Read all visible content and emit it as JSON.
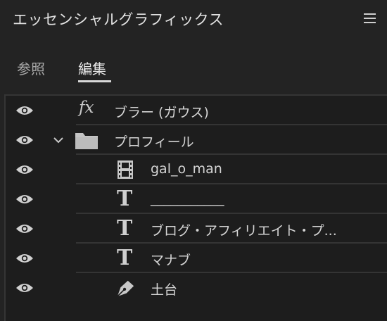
{
  "panel": {
    "title": "エッセンシャルグラフィックス",
    "menu_icon": "hamburger-menu-icon"
  },
  "tabs": [
    {
      "label": "参照",
      "active": false
    },
    {
      "label": "編集",
      "active": true
    }
  ],
  "layers": [
    {
      "label": "ブラー (ガウス)",
      "icon": "fx-effect-icon",
      "visible": true
    },
    {
      "label": "プロフィール",
      "icon": "folder-icon",
      "visible": true,
      "expanded": true
    },
    {
      "label": "gal_o_man",
      "icon": "film-clip-icon",
      "visible": true
    },
    {
      "label": "___________",
      "icon": "text-layer-icon",
      "visible": true
    },
    {
      "label": "ブログ・アフィリエイト・プ...",
      "icon": "text-layer-icon",
      "visible": true
    },
    {
      "label": "マナブ",
      "icon": "text-layer-icon",
      "visible": true
    },
    {
      "label": "土台",
      "icon": "pen-shape-icon",
      "visible": true
    }
  ],
  "colors": {
    "background": "#232323",
    "list_background": "#1d1d1d",
    "divider": "#343434",
    "text": "#d4d4d4"
  }
}
